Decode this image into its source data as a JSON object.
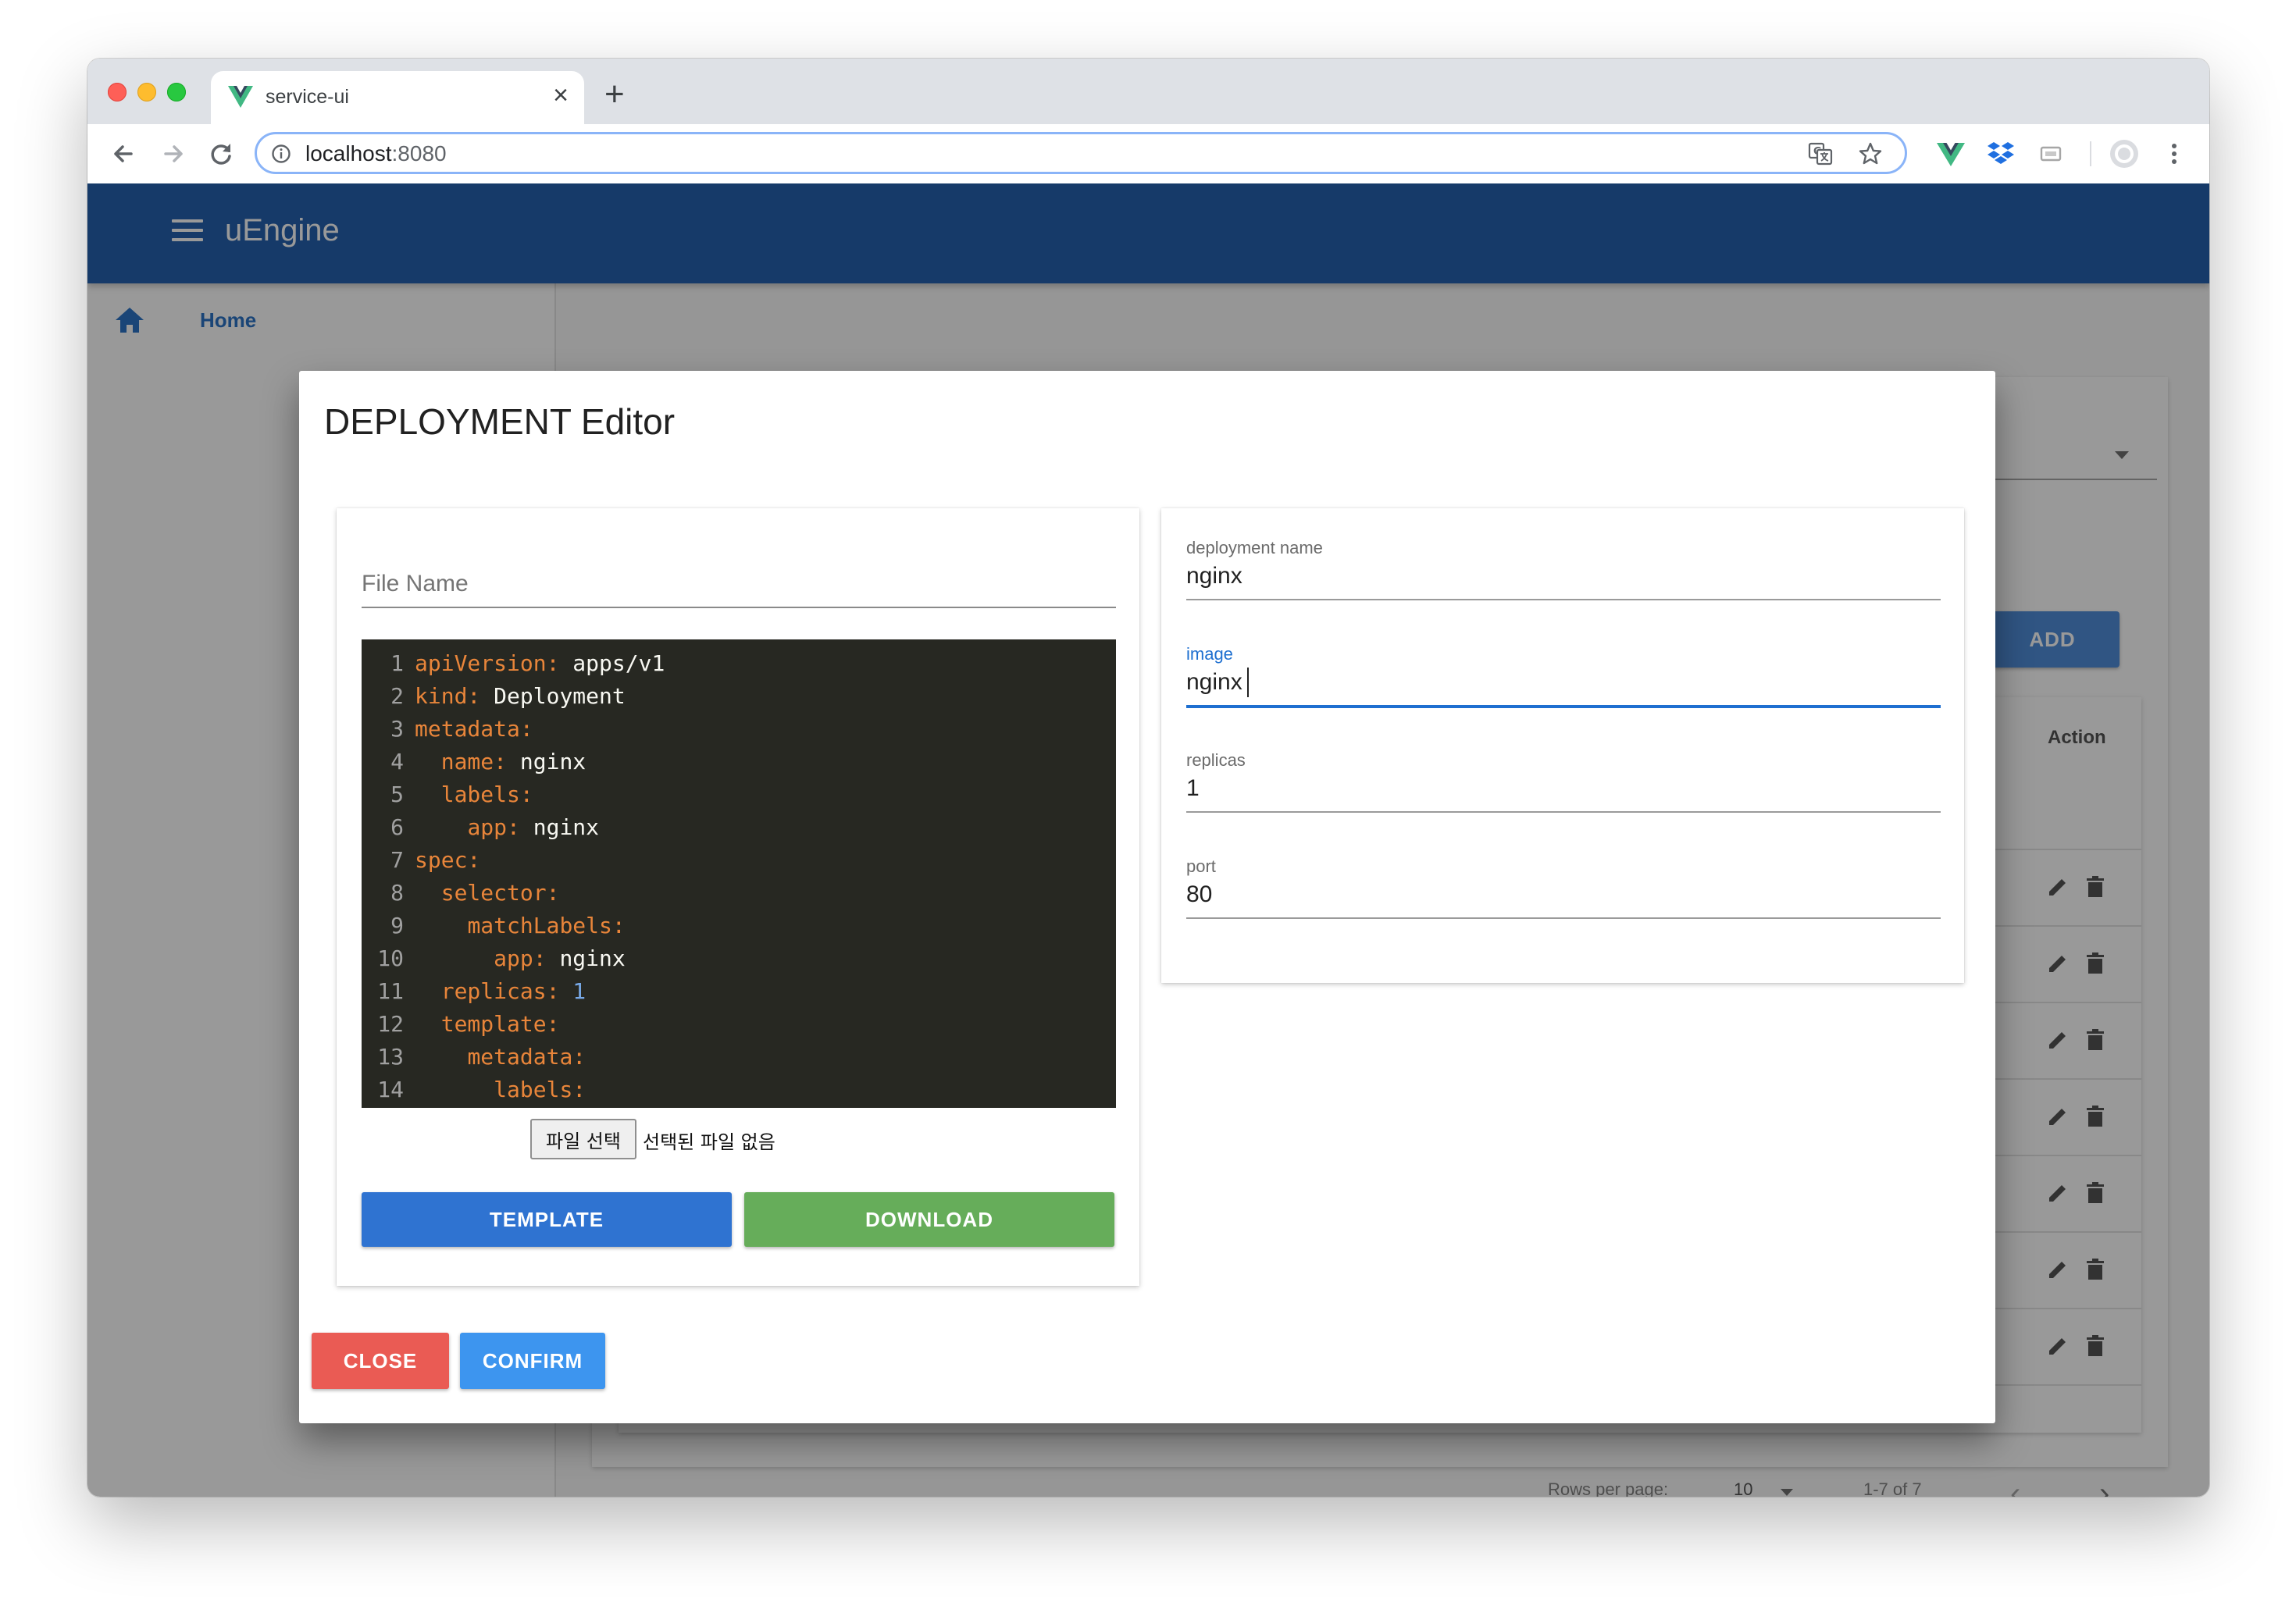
{
  "browser": {
    "tab_title": "service-ui",
    "close_tab": "×",
    "new_tab": "+",
    "url_host": "localhost",
    "url_port": ":8080"
  },
  "app": {
    "brand": "uEngine",
    "breadcrumb_home": "Home",
    "add_label": "ADD",
    "table_header_action": "Action",
    "rows_per_page_label": "Rows per page:",
    "rows_per_page_value": "10",
    "page_range": "1-7 of 7"
  },
  "dialog": {
    "title": "DEPLOYMENT Editor",
    "file_name_placeholder": "File Name",
    "file_choose_label": "파일 선택",
    "file_none_label": "선택된 파일 없음",
    "template_label": "TEMPLATE",
    "download_label": "DOWNLOAD",
    "close_label": "CLOSE",
    "confirm_label": "CONFIRM",
    "code_lines": [
      {
        "num": "1",
        "key": "apiVersion:",
        "val": " apps/v1",
        "indent": ""
      },
      {
        "num": "2",
        "key": "kind:",
        "val": " Deployment",
        "indent": ""
      },
      {
        "num": "3",
        "key": "metadata:",
        "val": "",
        "indent": ""
      },
      {
        "num": "4",
        "key": "name:",
        "val": " nginx",
        "indent": "  "
      },
      {
        "num": "5",
        "key": "labels:",
        "val": "",
        "indent": "  "
      },
      {
        "num": "6",
        "key": "app:",
        "val": " nginx",
        "indent": "    "
      },
      {
        "num": "7",
        "key": "spec:",
        "val": "",
        "indent": ""
      },
      {
        "num": "8",
        "key": "selector:",
        "val": "",
        "indent": "  "
      },
      {
        "num": "9",
        "key": "matchLabels:",
        "val": "",
        "indent": "    "
      },
      {
        "num": "10",
        "key": "app:",
        "val": " nginx",
        "indent": "      "
      },
      {
        "num": "11",
        "key": "replicas:",
        "val": " 1",
        "indent": "  ",
        "numeric": true
      },
      {
        "num": "12",
        "key": "template:",
        "val": "",
        "indent": "  "
      },
      {
        "num": "13",
        "key": "metadata:",
        "val": "",
        "indent": "    "
      },
      {
        "num": "14",
        "key": "labels:",
        "val": "",
        "indent": "      "
      }
    ],
    "fields": {
      "deployment_name": {
        "label": "deployment name",
        "value": "nginx"
      },
      "image": {
        "label": "image",
        "value": "nginx"
      },
      "replicas": {
        "label": "replicas",
        "value": "1"
      },
      "port": {
        "label": "port",
        "value": "80"
      }
    }
  },
  "icons": {
    "tab_favicon": "vue-logo-icon",
    "back": "arrow-back-icon",
    "forward": "arrow-forward-icon",
    "reload": "reload-icon",
    "info": "info-icon",
    "translate": "translate-icon",
    "bookmark": "star-icon",
    "extension_vue": "vue-devtools-icon",
    "extension_dropbox": "dropbox-icon",
    "extension_cast": "cast-icon",
    "profile": "profile-avatar-icon",
    "menu_more": "more-vert-icon",
    "hamburger": "menu-icon",
    "home": "home-icon",
    "edit": "pencil-icon",
    "delete": "trash-icon"
  },
  "colors": {
    "app_bar": "#0e50a6",
    "template_button": "#2f73d1",
    "download_button": "#66ad5a",
    "close_button": "#ea5b54",
    "confirm_button": "#3d95ef",
    "focus_accent": "#1e6fd0",
    "editor_background": "#272822",
    "yaml_key": "#e8853a"
  }
}
